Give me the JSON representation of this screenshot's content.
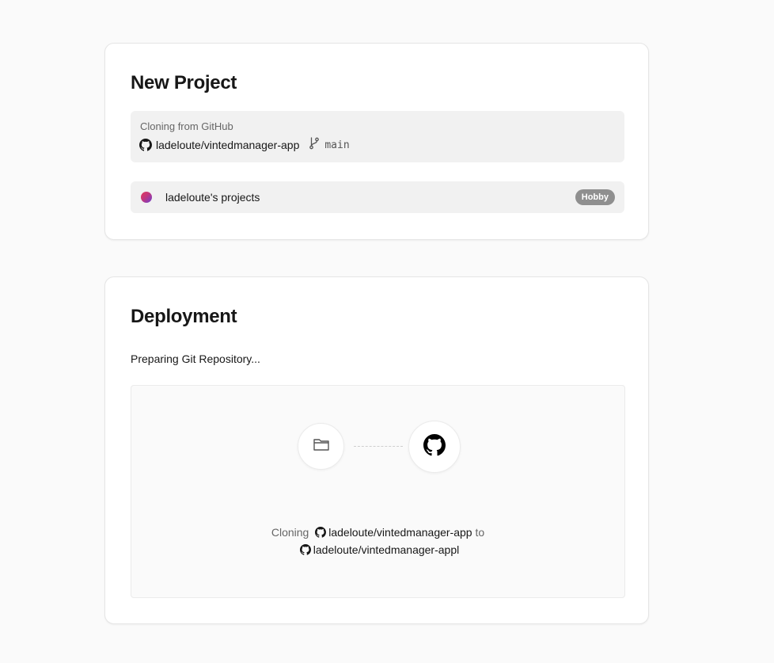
{
  "new_project": {
    "title": "New Project",
    "source": {
      "caption": "Cloning from GitHub",
      "repo": "ladeloute/vintedmanager-app",
      "branch": "main"
    },
    "scope": {
      "label": "ladeloute's projects",
      "plan_badge": "Hobby"
    }
  },
  "deployment": {
    "title": "Deployment",
    "status": "Preparing Git Repository...",
    "clone": {
      "prefix": "Cloning",
      "source_repo": "ladeloute/vintedmanager-app",
      "connector_word": "to",
      "target_repo": "ladeloute/vintedmanager-appl"
    }
  },
  "icons": {
    "source_github": "github-icon",
    "branch": "git-branch-icon",
    "folder": "folder-icon",
    "destination_github": "github-icon"
  },
  "colors": {
    "page_background": "#fafafa",
    "card_background": "#ffffff",
    "muted_box": "#f1f1f1",
    "badge_background": "#8f8f8f",
    "text_primary": "#171717",
    "text_muted": "#666666"
  }
}
